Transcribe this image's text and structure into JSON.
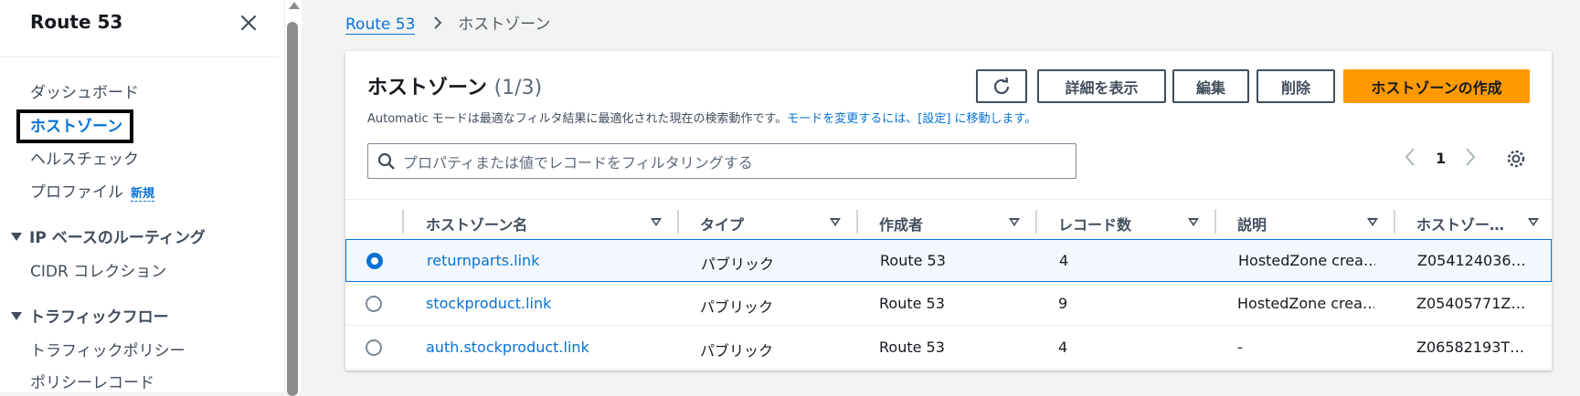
{
  "sidebar": {
    "title": "Route 53",
    "items": [
      {
        "label": "ダッシュボード"
      },
      {
        "label": "ホストゾーン"
      },
      {
        "label": "ヘルスチェック"
      },
      {
        "label": "プロファイル",
        "badge": "新規"
      }
    ],
    "sections": [
      {
        "label": "IP ベースのルーティング",
        "items": [
          {
            "label": "CIDR コレクション"
          }
        ]
      },
      {
        "label": "トラフィックフロー",
        "items": [
          {
            "label": "トラフィックポリシー"
          },
          {
            "label": "ポリシーレコード"
          }
        ]
      }
    ]
  },
  "breadcrumb": {
    "root": "Route 53",
    "current": "ホストゾーン"
  },
  "panel": {
    "title": "ホストゾーン",
    "count": "(1/3)",
    "description_prefix": "Automatic モードは最適なフィルタ結果に最適化された現在の検索動作です。",
    "description_link": "モードを変更するには、[設定] に移動します。",
    "buttons": {
      "refresh": "refresh-icon",
      "details": "詳細を表示",
      "edit": "編集",
      "delete": "削除",
      "create": "ホストゾーンの作成"
    },
    "search_placeholder": "プロパティまたは値でレコードをフィルタリングする",
    "page": "1"
  },
  "table": {
    "columns": [
      "ホストゾーン名",
      "タイプ",
      "作成者",
      "レコード数",
      "説明",
      "ホストゾー…"
    ],
    "rows": [
      {
        "name": "returnparts.link",
        "type": "パブリック",
        "creator": "Route 53",
        "records": "4",
        "description": "HostedZone crea…",
        "id": "Z054124036…",
        "selected": true
      },
      {
        "name": "stockproduct.link",
        "type": "パブリック",
        "creator": "Route 53",
        "records": "9",
        "description": "HostedZone crea…",
        "id": "Z05405771Z…",
        "selected": false
      },
      {
        "name": "auth.stockproduct.link",
        "type": "パブリック",
        "creator": "Route 53",
        "records": "4",
        "description": "-",
        "id": "Z06582193T…",
        "selected": false
      }
    ]
  },
  "colors": {
    "accent": "#0972d3",
    "primary_button": "#ff9900",
    "background": "#f2f3f3"
  }
}
